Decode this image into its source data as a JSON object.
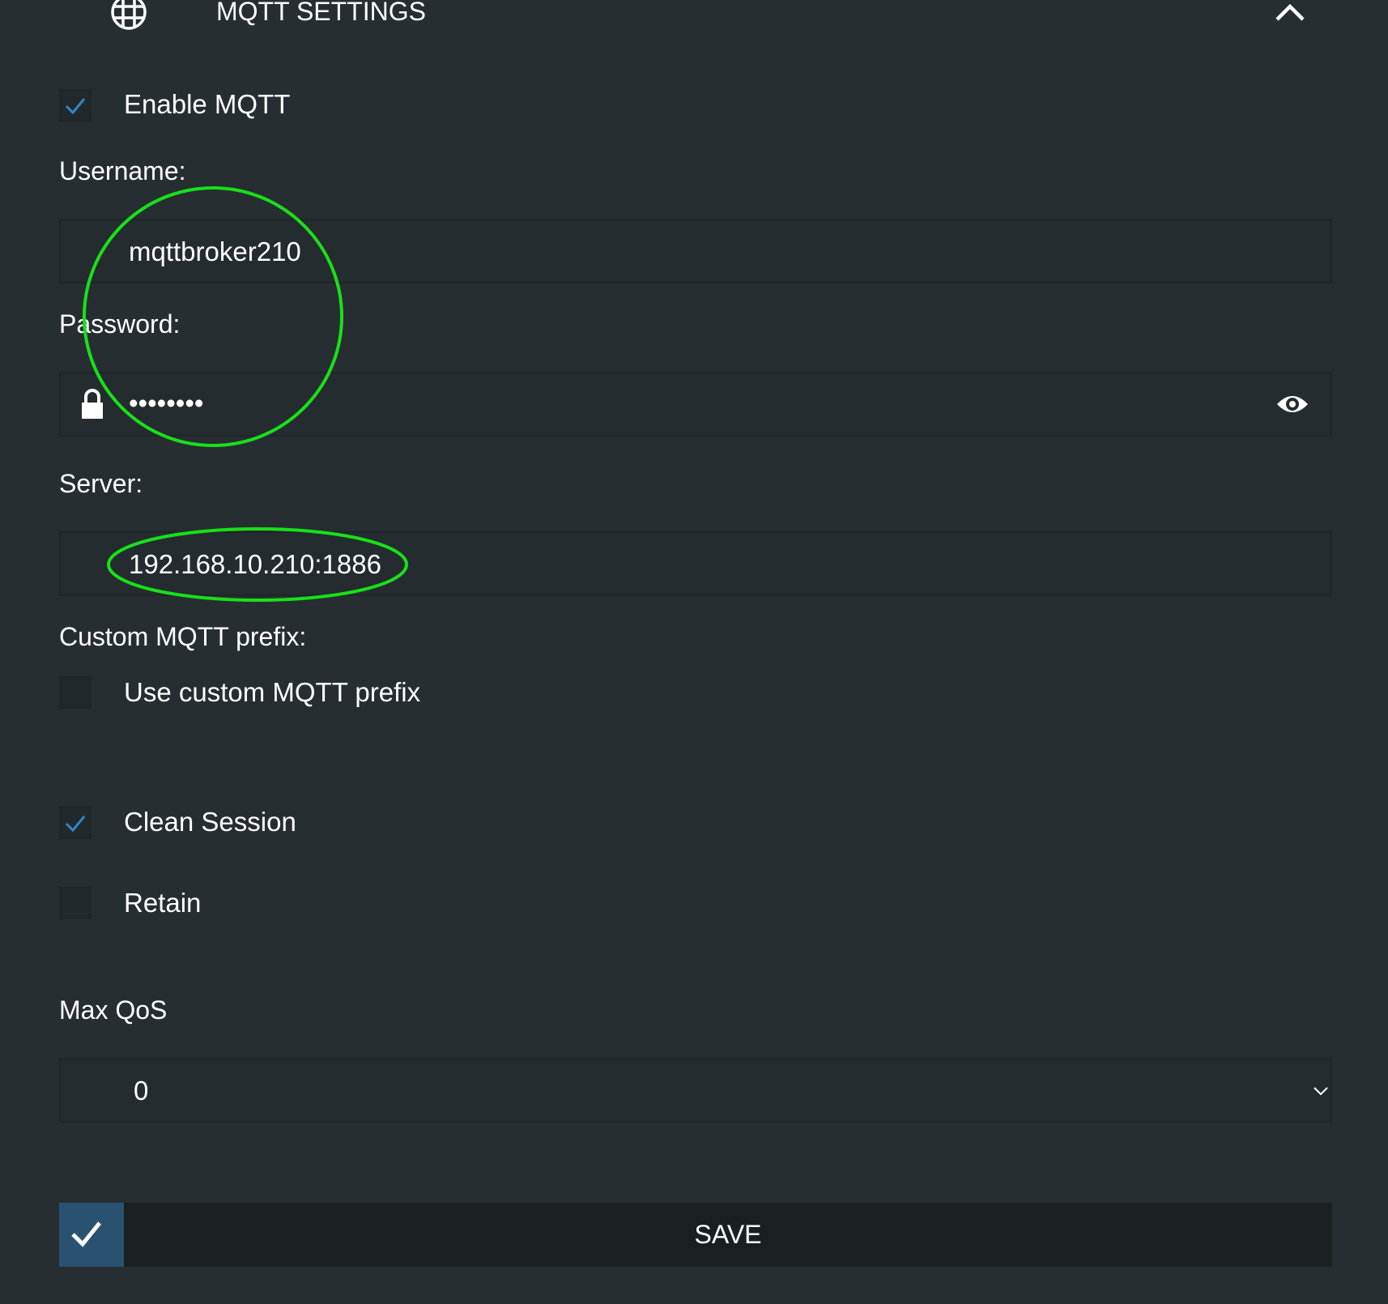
{
  "header": {
    "title": "MQTT SETTINGS",
    "icon": "globe-icon",
    "collapse_icon": "chevron-up-icon"
  },
  "enable_mqtt": {
    "label": "Enable MQTT",
    "checked": true
  },
  "username": {
    "label": "Username:",
    "value": "mqttbroker210"
  },
  "password": {
    "label": "Password:",
    "value": "••••••••",
    "icon": "lock-icon",
    "toggle_icon": "eye-icon"
  },
  "server": {
    "label": "Server:",
    "value": "192.168.10.210:1886"
  },
  "custom_prefix": {
    "label": "Custom MQTT prefix:",
    "checkbox_label": "Use custom MQTT prefix",
    "checked": false
  },
  "clean_session": {
    "label": "Clean Session",
    "checked": true
  },
  "retain": {
    "label": "Retain",
    "checked": false
  },
  "max_qos": {
    "label": "Max QoS",
    "value": "0"
  },
  "save": {
    "label": "SAVE"
  },
  "colors": {
    "background": "#272e31",
    "accent": "#2a5270",
    "check": "#2f86c9",
    "annotation": "#19e019"
  }
}
